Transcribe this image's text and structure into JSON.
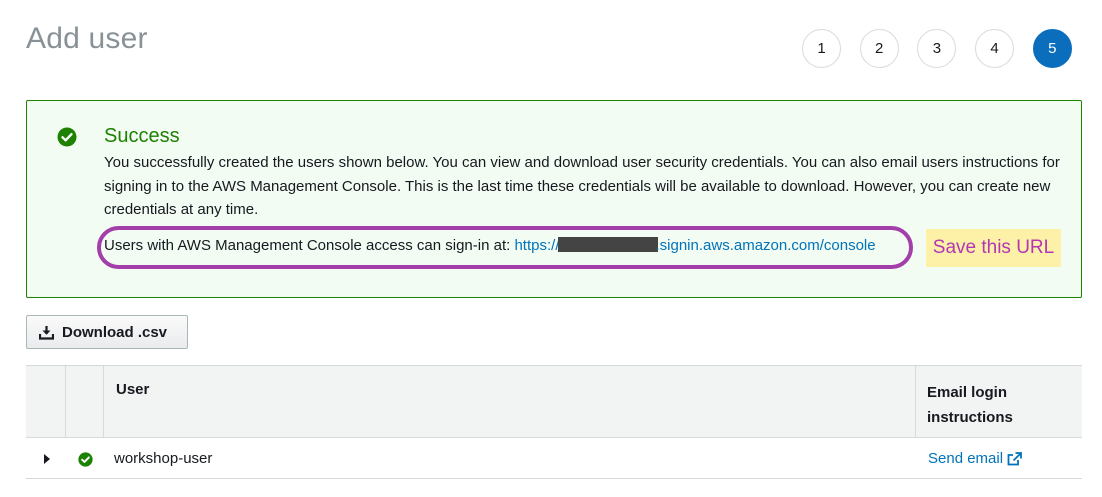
{
  "page": {
    "title": "Add user"
  },
  "steps": [
    "1",
    "2",
    "3",
    "4",
    "5"
  ],
  "active_step": "5",
  "alert": {
    "title": "Success",
    "message": "You successfully created the users shown below. You can view and download user security credentials. You can also email users instructions for signing in to the AWS Management Console. This is the last time these credentials will be available to download. However, you can create new credentials at any time.",
    "signin_prefix": "Users with AWS Management Console access can sign-in at: ",
    "signin_url_start": "https://",
    "signin_url_end": ".signin.aws.amazon.com/console",
    "success_icon": "check-circle-icon"
  },
  "annotation": {
    "note": "Save this URL"
  },
  "toolbar": {
    "download_label": "Download .csv",
    "download_icon": "download-icon"
  },
  "table": {
    "headers": {
      "user": "User",
      "email": "Email login instructions"
    },
    "rows": [
      {
        "user": "workshop-user",
        "status_icon": "check-circle-icon",
        "action": "Send email",
        "action_icon": "external-link-icon"
      }
    ]
  },
  "colors": {
    "success": "#1d8102",
    "link": "#0073bb",
    "active_step": "#0a6ebd",
    "annotation_border": "#a23fa9",
    "annotation_bg": "#fdf1a8"
  }
}
